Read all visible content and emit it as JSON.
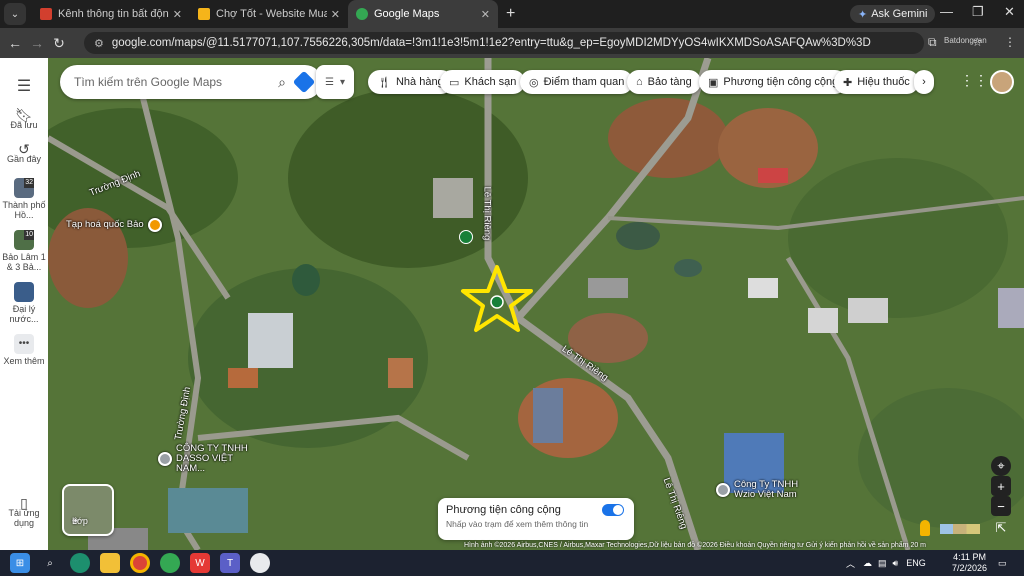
{
  "browser": {
    "tabs": [
      {
        "title": "Kênh thông tin bất động sản - ",
        "favicon_color": "#d23f2e"
      },
      {
        "title": "Chợ Tốt - Website Mua Bán, Rao",
        "favicon_color": "#f5b41a"
      },
      {
        "title": "Google Maps",
        "favicon_color": "#34a853"
      }
    ],
    "ask_gemini": "Ask Gemini",
    "url": "google.com/maps/@11.5177071,107.7556226,305m/data=!3m1!1e3!5m1!1e2?entry=ttu&g_ep=EgoyMDI2MDYyOS4wIKXMDSoASAFQAw%3D%3D",
    "watermark": "Batdongsan"
  },
  "sidebar": {
    "menu_icon": "hamburger-icon",
    "items": [
      {
        "label": "Đã lưu"
      },
      {
        "label": "Gần đây"
      },
      {
        "label": "Thành phố Hồ...",
        "badge": "32"
      },
      {
        "label": "Bảo Lâm 1 & 3 Bả...",
        "badge": "10"
      },
      {
        "label": "Đại lý nước..."
      },
      {
        "label": "Xem thêm"
      },
      {
        "label": "Tải ứng dụng"
      }
    ]
  },
  "search": {
    "placeholder": "Tìm kiếm trên Google Maps"
  },
  "chips": [
    {
      "label": "Nhà hàng",
      "icon": "fork-knife-icon"
    },
    {
      "label": "Khách sạn",
      "icon": "bed-icon"
    },
    {
      "label": "Điểm tham quan",
      "icon": "camera-icon"
    },
    {
      "label": "Bảo tàng",
      "icon": "museum-icon"
    },
    {
      "label": "Phương tiện công cộng",
      "icon": "bus-icon"
    },
    {
      "label": "Hiệu thuốc",
      "icon": "pharmacy-icon"
    }
  ],
  "map": {
    "roads": [
      "Trường Định",
      "Lê Thị Riêng",
      "Lê Thị Riêng",
      "Trường Định",
      "Lê Thị Riêng"
    ],
    "pois": [
      {
        "name": "Tạp hoá quốc Bảo",
        "kind": "shop"
      },
      {
        "name": "CÔNG TY TNHH DASSO VIỆT NAM...",
        "kind": "company"
      },
      {
        "name": "Công Ty TNHH Wzio Việt Nam",
        "kind": "company"
      }
    ],
    "layers_label": "Lớp",
    "attribution": "Hình ảnh ©2026 Airbus,CNES / Airbus,Maxar Technologies,Dữ liệu bản đồ ©2026   Điều khoản   Quyền riêng tư   Gửi ý kiến phản hồi về sản phẩm   20 m",
    "marker": "star-marker"
  },
  "transit_card": {
    "title": "Phương tiện công cộng",
    "subtitle": "Nhấp vào trạm để xem thêm thông tin",
    "enabled": true
  },
  "taskbar": {
    "lang": "ENG",
    "time": "4:11 PM",
    "date": "7/2/2026"
  }
}
